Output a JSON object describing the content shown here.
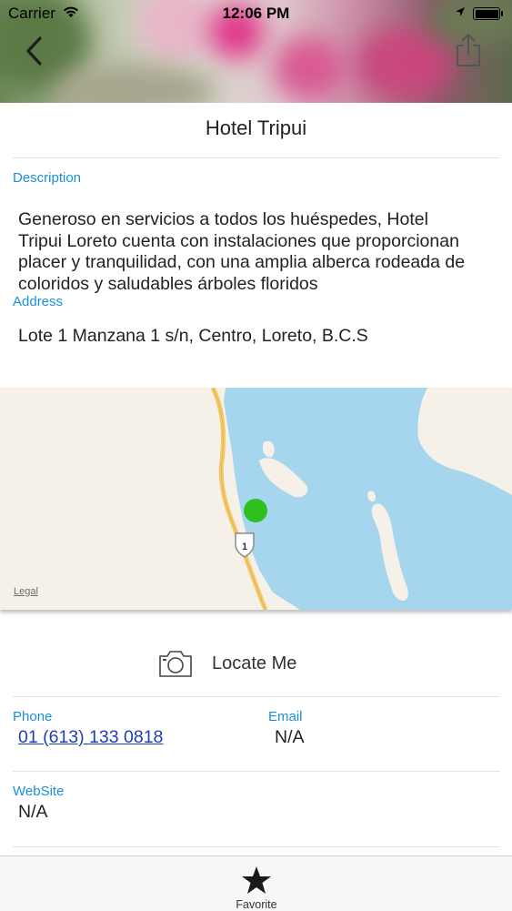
{
  "status_bar": {
    "carrier": "Carrier",
    "time": "12:06 PM"
  },
  "header": {
    "back_icon": "chevron-left-icon",
    "share_icon": "share-icon"
  },
  "hotel": {
    "title": "Hotel Tripui",
    "description_label": "Description",
    "description_line1": "Generoso en servicios a todos los huéspedes, Hotel",
    "description_line2": "Tripui Loreto cuenta con instalaciones que proporcionan",
    "description_line3": "placer y tranquilidad, con una amplia alberca rodeada de",
    "description_line4": "coloridos y saludables árboles floridos",
    "address_label": "Address",
    "address": "Lote 1 Manzana 1 s/n, Centro, Loreto, B.C.S"
  },
  "map": {
    "legal": "Legal",
    "route_shield": "1",
    "pin_color": "#2fbf1f",
    "water_color": "#a6d6ee",
    "land_color": "#f6f1e8",
    "road_color": "#f2c96a"
  },
  "actions": {
    "locate_label": "Locate Me",
    "locate_icon": "camera-icon"
  },
  "contact": {
    "phone_label": "Phone",
    "phone": "01 (613) 133 0818",
    "email_label": "Email",
    "email": "N/A",
    "website_label": "WebSite",
    "website": "N/A"
  },
  "tabbar": {
    "favorite_label": "Favorite",
    "favorite_icon": "star-icon"
  },
  "colors": {
    "accent": "#1a8fd8",
    "link": "#1f3fb0"
  }
}
